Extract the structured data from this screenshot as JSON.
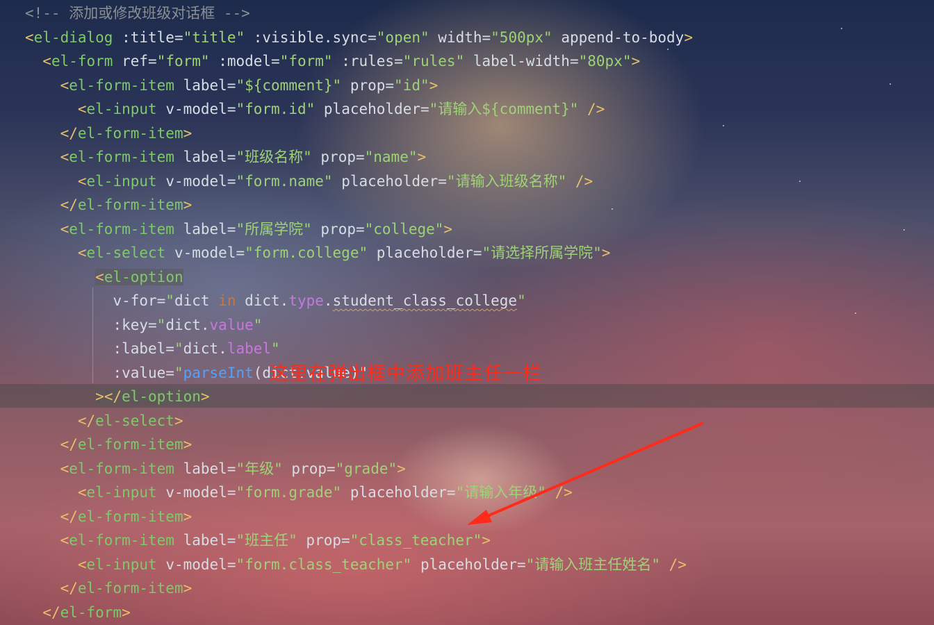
{
  "annotation_text": "这里在弹出框中添加班主任一栏",
  "colors": {
    "annotation": "#ff2a1a",
    "arrow": "#ff2a1a"
  },
  "code_lines": [
    [
      {
        "t": "<!-- 添加或修改班级对话框 -->",
        "c": "comment"
      }
    ],
    [
      {
        "t": "<",
        "c": "tag"
      },
      {
        "t": "el-dialog",
        "c": "tagname"
      },
      {
        "t": " :title=",
        "c": "attr"
      },
      {
        "t": "\"title\"",
        "c": "str"
      },
      {
        "t": " :visible.sync=",
        "c": "attr"
      },
      {
        "t": "\"open\"",
        "c": "str"
      },
      {
        "t": " width=",
        "c": "attr"
      },
      {
        "t": "\"500px\"",
        "c": "str"
      },
      {
        "t": " append-to-body",
        "c": "attr"
      },
      {
        "t": ">",
        "c": "tag"
      }
    ],
    [
      {
        "t": "  "
      },
      {
        "t": "<",
        "c": "tag"
      },
      {
        "t": "el-form",
        "c": "tagname"
      },
      {
        "t": " ref=",
        "c": "attr"
      },
      {
        "t": "\"form\"",
        "c": "str"
      },
      {
        "t": " :model=",
        "c": "attr"
      },
      {
        "t": "\"form\"",
        "c": "str"
      },
      {
        "t": " :rules=",
        "c": "attr"
      },
      {
        "t": "\"rules\"",
        "c": "str"
      },
      {
        "t": " label-width=",
        "c": "attr"
      },
      {
        "t": "\"80px\"",
        "c": "str"
      },
      {
        "t": ">",
        "c": "tag"
      }
    ],
    [
      {
        "t": "    "
      },
      {
        "t": "<",
        "c": "tag"
      },
      {
        "t": "el-form-item",
        "c": "tagname"
      },
      {
        "t": " label=",
        "c": "attr"
      },
      {
        "t": "\"${comment}\"",
        "c": "str"
      },
      {
        "t": " prop=",
        "c": "attr"
      },
      {
        "t": "\"id\"",
        "c": "str"
      },
      {
        "t": ">",
        "c": "tag"
      }
    ],
    [
      {
        "t": "      "
      },
      {
        "t": "<",
        "c": "tag"
      },
      {
        "t": "el-input",
        "c": "tagname"
      },
      {
        "t": " v-model=",
        "c": "attr"
      },
      {
        "t": "\"form.id\"",
        "c": "str"
      },
      {
        "t": " placeholder=",
        "c": "attr"
      },
      {
        "t": "\"请输入${comment}\"",
        "c": "str"
      },
      {
        "t": " />",
        "c": "tag"
      }
    ],
    [
      {
        "t": "    "
      },
      {
        "t": "</",
        "c": "tag"
      },
      {
        "t": "el-form-item",
        "c": "tagname"
      },
      {
        "t": ">",
        "c": "tag"
      }
    ],
    [
      {
        "t": "    "
      },
      {
        "t": "<",
        "c": "tag"
      },
      {
        "t": "el-form-item",
        "c": "tagname"
      },
      {
        "t": " label=",
        "c": "attr"
      },
      {
        "t": "\"班级名称\"",
        "c": "str"
      },
      {
        "t": " prop=",
        "c": "attr"
      },
      {
        "t": "\"name\"",
        "c": "str"
      },
      {
        "t": ">",
        "c": "tag"
      }
    ],
    [
      {
        "t": "      "
      },
      {
        "t": "<",
        "c": "tag"
      },
      {
        "t": "el-input",
        "c": "tagname"
      },
      {
        "t": " v-model=",
        "c": "attr"
      },
      {
        "t": "\"form.name\"",
        "c": "str"
      },
      {
        "t": " placeholder=",
        "c": "attr"
      },
      {
        "t": "\"请输入班级名称\"",
        "c": "str"
      },
      {
        "t": " />",
        "c": "tag"
      }
    ],
    [
      {
        "t": "    "
      },
      {
        "t": "</",
        "c": "tag"
      },
      {
        "t": "el-form-item",
        "c": "tagname"
      },
      {
        "t": ">",
        "c": "tag"
      }
    ],
    [
      {
        "t": "    "
      },
      {
        "t": "<",
        "c": "tag"
      },
      {
        "t": "el-form-item",
        "c": "tagname"
      },
      {
        "t": " label=",
        "c": "attr"
      },
      {
        "t": "\"所属学院\"",
        "c": "str"
      },
      {
        "t": " prop=",
        "c": "attr"
      },
      {
        "t": "\"college\"",
        "c": "str"
      },
      {
        "t": ">",
        "c": "tag"
      }
    ],
    [
      {
        "t": "      "
      },
      {
        "t": "<",
        "c": "tag"
      },
      {
        "t": "el-select",
        "c": "tagname"
      },
      {
        "t": " v-model=",
        "c": "attr"
      },
      {
        "t": "\"form.college\"",
        "c": "str"
      },
      {
        "t": " placeholder=",
        "c": "attr"
      },
      {
        "t": "\"请选择所属学院\"",
        "c": "str"
      },
      {
        "t": ">",
        "c": "tag"
      }
    ],
    [
      {
        "t": "        "
      },
      {
        "t": "<",
        "c": "tag",
        "h": true
      },
      {
        "t": "el-option",
        "c": "tagname",
        "h": true
      }
    ],
    [
      {
        "t": "          "
      },
      {
        "t": "v-for=",
        "c": "attr"
      },
      {
        "t": "\"",
        "c": "str"
      },
      {
        "t": "dict ",
        "c": "def"
      },
      {
        "t": "in",
        "c": "kw"
      },
      {
        "t": " dict.",
        "c": "def"
      },
      {
        "t": "type",
        "c": "prop"
      },
      {
        "t": ".",
        "c": "def"
      },
      {
        "t": "student_class_college",
        "c": "def",
        "sq": true
      },
      {
        "t": "\"",
        "c": "str"
      }
    ],
    [
      {
        "t": "          "
      },
      {
        "t": ":key=",
        "c": "attr"
      },
      {
        "t": "\"",
        "c": "str"
      },
      {
        "t": "dict.",
        "c": "def"
      },
      {
        "t": "value",
        "c": "prop"
      },
      {
        "t": "\"",
        "c": "str"
      }
    ],
    [
      {
        "t": "          "
      },
      {
        "t": ":label=",
        "c": "attr"
      },
      {
        "t": "\"",
        "c": "str"
      },
      {
        "t": "dict.",
        "c": "def"
      },
      {
        "t": "label",
        "c": "prop"
      },
      {
        "t": "\"",
        "c": "str"
      }
    ],
    [
      {
        "t": "          "
      },
      {
        "t": ":value=",
        "c": "attr"
      },
      {
        "t": "\"",
        "c": "str"
      },
      {
        "t": "parseInt",
        "c": "fn"
      },
      {
        "t": "(dict.value)\"",
        "c": "def"
      }
    ],
    [
      {
        "t": "        "
      },
      {
        "t": ">",
        "c": "tag",
        "h": true
      },
      {
        "t": "</",
        "c": "tag",
        "h": true
      },
      {
        "t": "el-option",
        "c": "tagname",
        "h": true
      },
      {
        "t": ">",
        "c": "tag",
        "h": true
      }
    ],
    [
      {
        "t": "      "
      },
      {
        "t": "</",
        "c": "tag"
      },
      {
        "t": "el-select",
        "c": "tagname"
      },
      {
        "t": ">",
        "c": "tag"
      }
    ],
    [
      {
        "t": "    "
      },
      {
        "t": "</",
        "c": "tag"
      },
      {
        "t": "el-form-item",
        "c": "tagname"
      },
      {
        "t": ">",
        "c": "tag"
      }
    ],
    [
      {
        "t": "    "
      },
      {
        "t": "<",
        "c": "tag"
      },
      {
        "t": "el-form-item",
        "c": "tagname"
      },
      {
        "t": " label=",
        "c": "attr"
      },
      {
        "t": "\"年级\"",
        "c": "str"
      },
      {
        "t": " prop=",
        "c": "attr"
      },
      {
        "t": "\"grade\"",
        "c": "str"
      },
      {
        "t": ">",
        "c": "tag"
      }
    ],
    [
      {
        "t": "      "
      },
      {
        "t": "<",
        "c": "tag"
      },
      {
        "t": "el-input",
        "c": "tagname"
      },
      {
        "t": " v-model=",
        "c": "attr"
      },
      {
        "t": "\"form.grade\"",
        "c": "str"
      },
      {
        "t": " placeholder=",
        "c": "attr"
      },
      {
        "t": "\"请输入年级\"",
        "c": "str"
      },
      {
        "t": " />",
        "c": "tag"
      }
    ],
    [
      {
        "t": "    "
      },
      {
        "t": "</",
        "c": "tag"
      },
      {
        "t": "el-form-item",
        "c": "tagname"
      },
      {
        "t": ">",
        "c": "tag"
      }
    ],
    [
      {
        "t": "    "
      },
      {
        "t": "<",
        "c": "tag"
      },
      {
        "t": "el-form-item",
        "c": "tagname"
      },
      {
        "t": " label=",
        "c": "attr"
      },
      {
        "t": "\"班主任\"",
        "c": "str"
      },
      {
        "t": " prop=",
        "c": "attr"
      },
      {
        "t": "\"class_teacher\"",
        "c": "str"
      },
      {
        "t": ">",
        "c": "tag"
      }
    ],
    [
      {
        "t": "      "
      },
      {
        "t": "<",
        "c": "tag"
      },
      {
        "t": "el-input",
        "c": "tagname"
      },
      {
        "t": " v-model=",
        "c": "attr"
      },
      {
        "t": "\"form.class_teacher\"",
        "c": "str"
      },
      {
        "t": " placeholder=",
        "c": "attr"
      },
      {
        "t": "\"请输入班主任姓名\"",
        "c": "str"
      },
      {
        "t": " />",
        "c": "tag"
      }
    ],
    [
      {
        "t": "    "
      },
      {
        "t": "</",
        "c": "tag"
      },
      {
        "t": "el-form-item",
        "c": "tagname"
      },
      {
        "t": ">",
        "c": "tag"
      }
    ],
    [
      {
        "t": "  "
      },
      {
        "t": "</",
        "c": "tag"
      },
      {
        "t": "el-form",
        "c": "tagname"
      },
      {
        "t": ">",
        "c": "tag"
      }
    ]
  ]
}
